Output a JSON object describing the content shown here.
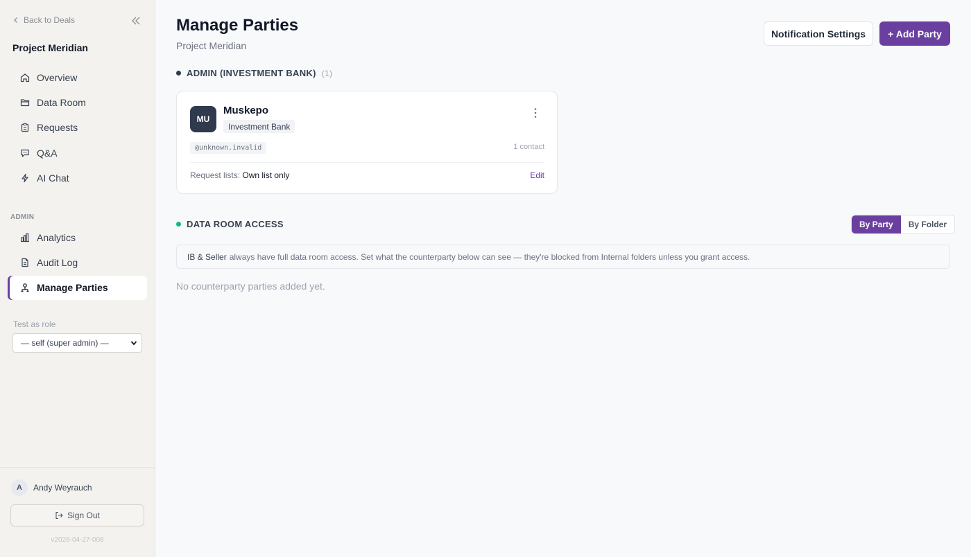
{
  "sidebar": {
    "back_label": "Back to Deals",
    "project_name": "Project Meridian",
    "nav_items": [
      {
        "label": "Overview",
        "icon": "home-icon"
      },
      {
        "label": "Data Room",
        "icon": "folder-icon"
      },
      {
        "label": "Requests",
        "icon": "clipboard-icon"
      },
      {
        "label": "Q&A",
        "icon": "chat-bubble-icon"
      },
      {
        "label": "AI Chat",
        "icon": "lightning-icon"
      }
    ],
    "admin_section_label": "ADMIN",
    "admin_items": [
      {
        "label": "Analytics",
        "icon": "bar-chart-icon"
      },
      {
        "label": "Audit Log",
        "icon": "document-icon"
      },
      {
        "label": "Manage Parties",
        "icon": "people-icon",
        "active": true
      }
    ],
    "role_label": "Test as role",
    "role_value": "— self (super admin) —",
    "user": {
      "initial": "A",
      "name": "Andy Weyrauch"
    },
    "signout_label": "Sign Out",
    "version": "v2026-04-27-008"
  },
  "header": {
    "title": "Manage Parties",
    "subtitle": "Project Meridian",
    "notification_button": "Notification Settings",
    "add_button": "+ Add Party"
  },
  "admin_section": {
    "title": "ADMIN (INVESTMENT BANK)",
    "count": "(1)",
    "dot_color": "#2f3a4d",
    "party": {
      "initials": "MU",
      "name": "Muskepo",
      "type": "Investment Bank",
      "domain": "@unknown.invalid",
      "contacts": "1 contact",
      "request_lists_label": "Request lists:",
      "request_lists_value": "Own list only",
      "edit_label": "Edit"
    }
  },
  "data_room_section": {
    "title": "DATA ROOM ACCESS",
    "dot_color": "#10b981",
    "toggle": {
      "by_party": "By Party",
      "by_folder": "By Folder",
      "selected": "By Party"
    },
    "info_strong": "IB & Seller",
    "info_text": "always have full data room access. Set what the counterparty below can see — they're blocked from Internal folders unless you grant access.",
    "empty_message": "No counterparty parties added yet."
  },
  "colors": {
    "accent": "#6b3fa0",
    "sidebar_bg": "#f3f2ee",
    "main_bg": "#f8f9fb"
  }
}
